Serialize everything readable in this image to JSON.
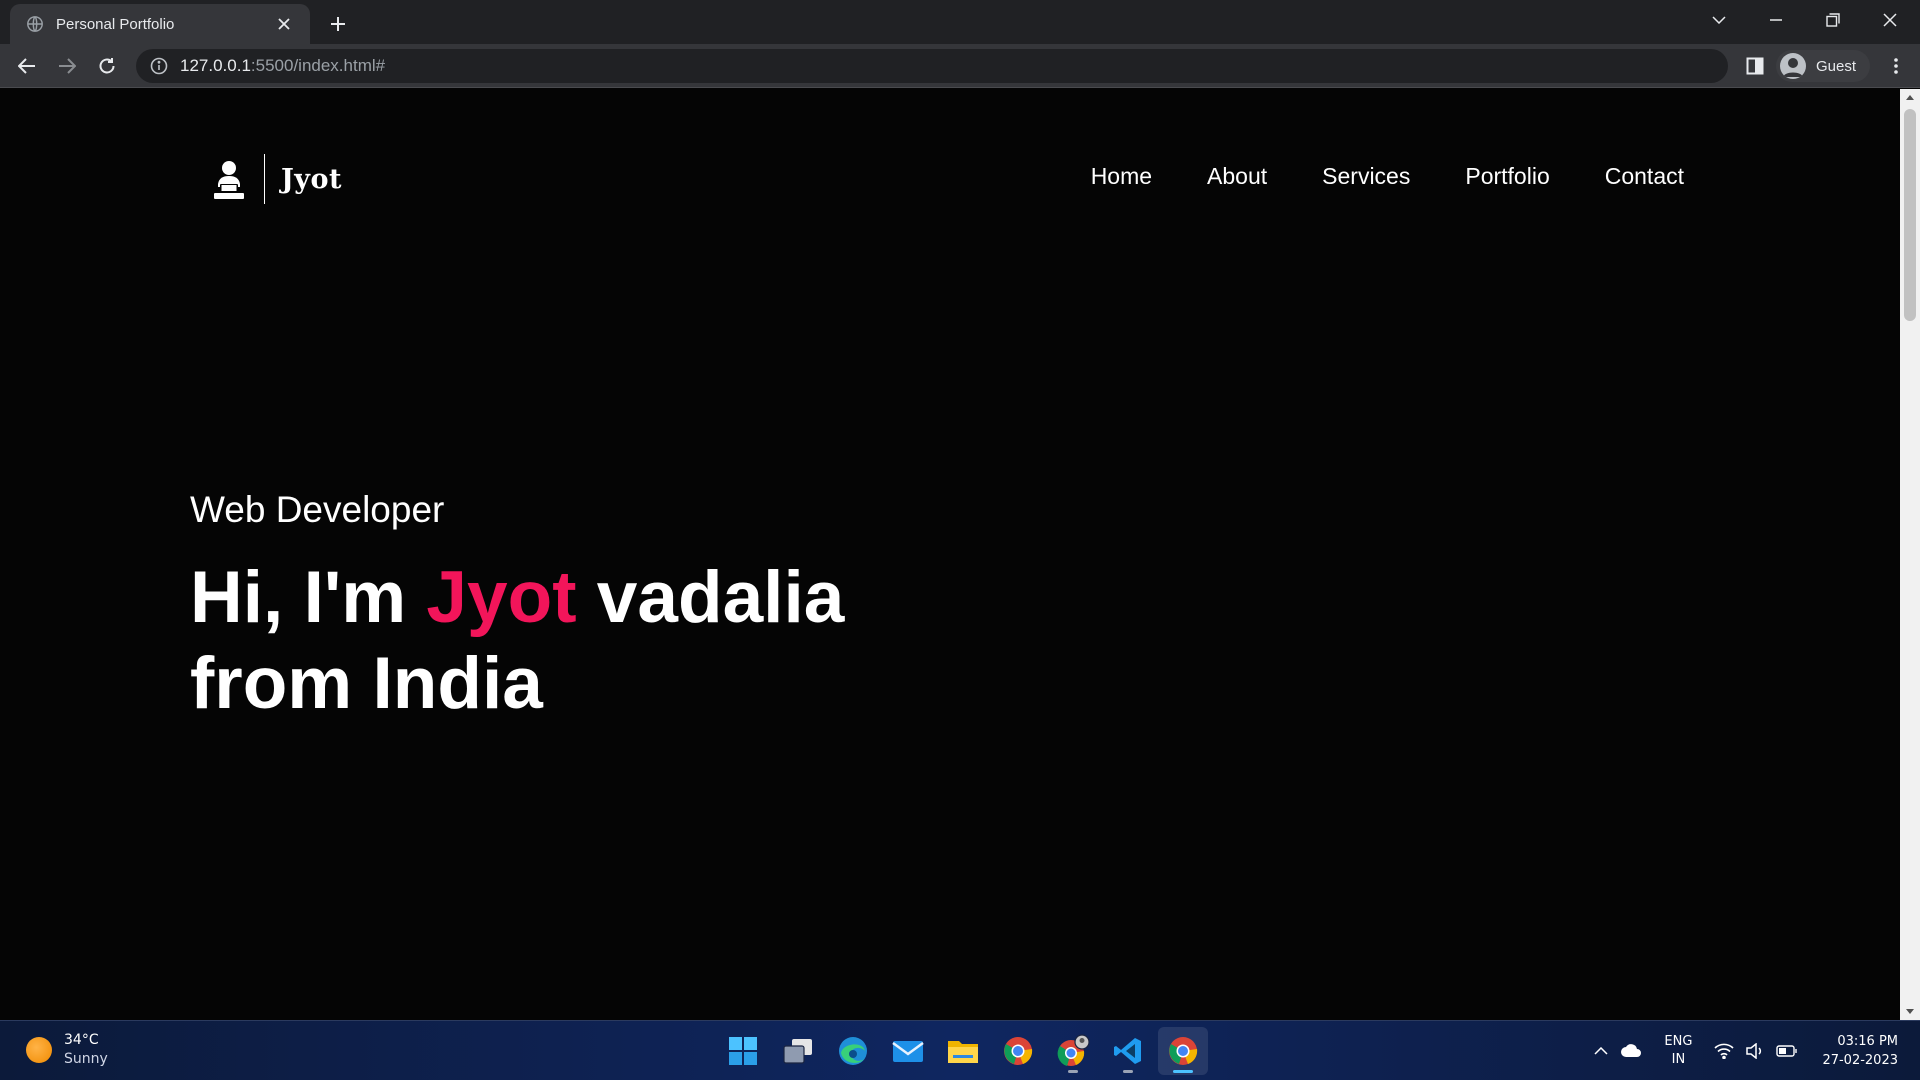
{
  "browser": {
    "tab_title": "Personal Portfolio",
    "url_host": "127.0.0.1",
    "url_rest": ":5500/index.html#",
    "profile_label": "Guest"
  },
  "page": {
    "logo_text": "Jyot",
    "nav": [
      "Home",
      "About",
      "Services",
      "Portfolio",
      "Contact"
    ],
    "hero_subtitle": "Web Developer",
    "hero_title_pre": "Hi, I'm ",
    "hero_title_accent": "Jyot",
    "hero_title_post": " vadalia",
    "hero_title_line2": "from India",
    "accent_color": "#f2155a"
  },
  "taskbar": {
    "weather_temp": "34°C",
    "weather_desc": "Sunny",
    "apps": [
      "windows-start",
      "task-view",
      "edge",
      "mail",
      "file-explorer",
      "chrome",
      "chrome-profile",
      "vscode",
      "chrome-active"
    ],
    "lang_primary": "ENG",
    "lang_secondary": "IN",
    "time": "03:16 PM",
    "date": "27-02-2023"
  }
}
